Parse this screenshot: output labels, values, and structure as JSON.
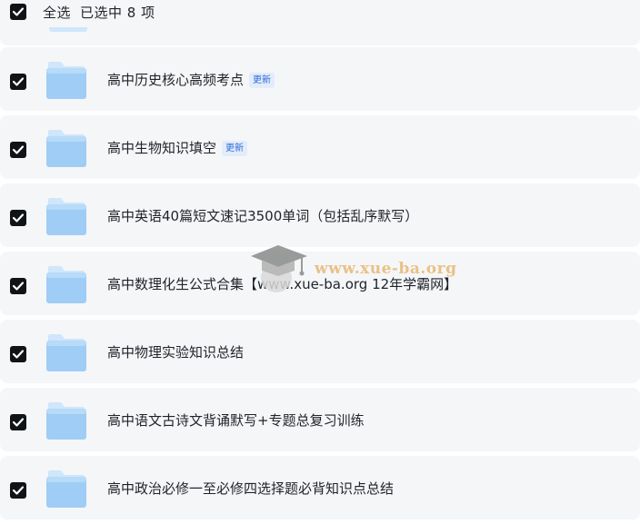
{
  "toolbar": {
    "select_all_label": "全选",
    "selected_count_label": "已选中 8 项"
  },
  "files": [
    {
      "name": "高中历史核心高频考点",
      "badge": "更新",
      "checked": true
    },
    {
      "name": "高中生物知识填空",
      "badge": "更新",
      "checked": true
    },
    {
      "name": "高中英语40篇短文速记3500单词（包括乱序默写）",
      "badge": "",
      "checked": true
    },
    {
      "name": "高中数理化生公式合集【www.xue-ba.org 12年学霸网】",
      "badge": "",
      "checked": true
    },
    {
      "name": "高中物理实验知识总结",
      "badge": "",
      "checked": true
    },
    {
      "name": "高中语文古诗文背诵默写+专题总复习训练",
      "badge": "",
      "checked": true
    },
    {
      "name": "高中政治必修一至必修四选择题必背知识点总结",
      "badge": "",
      "checked": true
    }
  ],
  "watermark": {
    "text": "www.xue-ba.org"
  },
  "colors": {
    "row_background": "#f5f6f8",
    "checkbox": "#111417",
    "folder_light": "#cfe6fb",
    "folder_main": "#9fcdf5",
    "badge_text": "#2f6bd6",
    "badge_background": "#e3ecfb",
    "watermark": "#e8b873"
  },
  "icons": {
    "folder": "folder-icon",
    "check": "checkmark-icon",
    "watermark_logo": "graduation-cap-icon"
  }
}
